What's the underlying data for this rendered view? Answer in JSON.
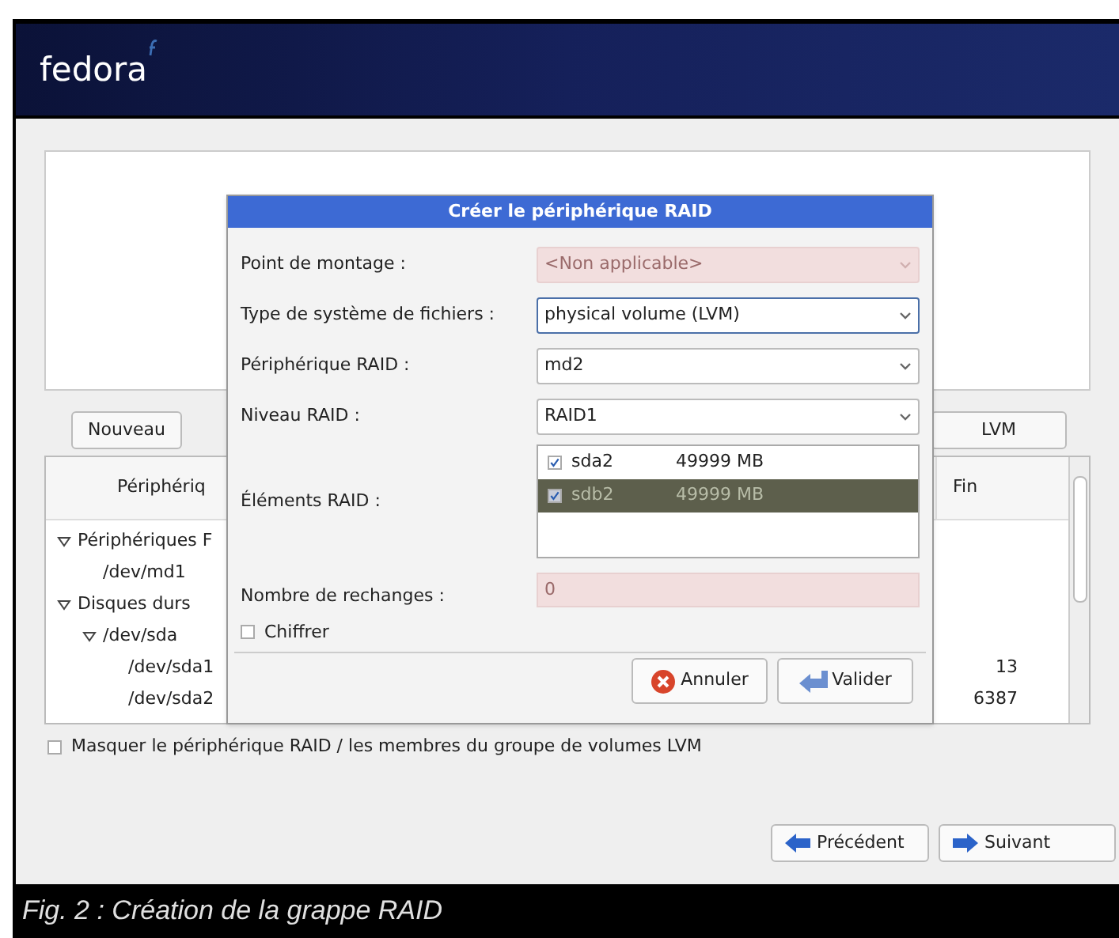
{
  "header": {
    "logo": "fedora"
  },
  "toolbar": [
    {
      "label": "Nouveau"
    },
    {
      "label": "LVM"
    }
  ],
  "tree": {
    "columns": [
      "Périphériq",
      "Fin"
    ],
    "rows": [
      {
        "label": "Périphériques F",
        "expanded": true,
        "children": [
          {
            "label": "/dev/md1"
          }
        ]
      },
      {
        "label": "Disques durs",
        "expanded": true,
        "children": [
          {
            "label": "/dev/sda",
            "expanded": true,
            "children": [
              {
                "label": "/dev/sda1",
                "fin": "13"
              },
              {
                "label": "/dev/sda2",
                "fin": "6387"
              }
            ]
          }
        ]
      }
    ]
  },
  "hide_option": {
    "label": "Masquer le périphérique RAID / les membres du groupe de volumes LVM",
    "checked": false
  },
  "nav_buttons": [
    {
      "label": "Précédent",
      "kind": "back"
    },
    {
      "label": "Suivant",
      "kind": "next"
    }
  ],
  "dialog": {
    "title": "Créer le périphérique RAID",
    "fields": [
      {
        "label": "Point de montage :",
        "value": "<Non applicable>",
        "disabled": true,
        "focused": false
      },
      {
        "label": "Type de système de fichiers :",
        "value": "physical volume (LVM)",
        "disabled": false,
        "focused": true
      },
      {
        "label": "Périphérique RAID :",
        "value": "md2",
        "disabled": false,
        "focused": false
      },
      {
        "label": "Niveau RAID :",
        "value": "RAID1",
        "disabled": false,
        "focused": false
      }
    ],
    "members": {
      "label": "Éléments RAID :",
      "items": [
        {
          "name": "sda2",
          "size": "49999 MB",
          "checked": true,
          "selected": false
        },
        {
          "name": "sdb2",
          "size": "49999 MB",
          "checked": true,
          "selected": true
        }
      ]
    },
    "spares": {
      "label": "Nombre de rechanges :",
      "value": "0",
      "disabled": true
    },
    "encrypt": {
      "label": "Chiffrer",
      "checked": false
    },
    "buttons": [
      {
        "label": "Annuler",
        "kind": "cancel"
      },
      {
        "label": "Valider",
        "kind": "ok"
      }
    ]
  },
  "caption": "Fig. 2 : Création de la grappe RAID"
}
